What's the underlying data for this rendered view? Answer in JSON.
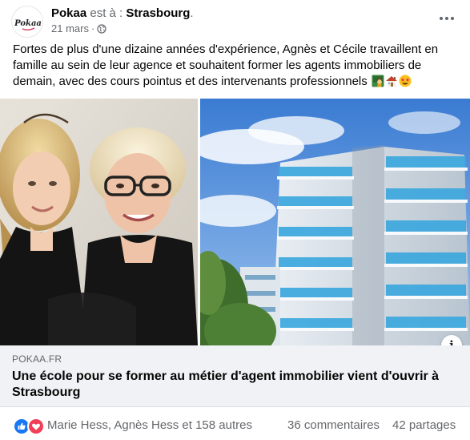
{
  "post": {
    "page_name": "Pokaa",
    "is_at": "est à :",
    "location": "Strasbourg",
    "location_dot": ".",
    "date": "21 mars",
    "dot": "·",
    "privacy_icon": "globe-icon",
    "logo_text": "Pokaa",
    "text": "Fortes de plus d'une dizaine années d'expérience, Agnès et Cécile travaillent en famille au sein de leur agence et souhaitent former les agents immobiliers de demain, avec des cours pointus et des intervenants professionnels",
    "emojis": [
      "woman-teacher-emoji",
      "house-emoji",
      "star-struck-emoji"
    ]
  },
  "link_preview": {
    "domain": "POKAA.FR",
    "title": "Une école pour se former au métier d'agent immobilier vient d'ouvrir à Strasbourg",
    "info_label": "i"
  },
  "footer": {
    "reactions": [
      "like-reaction-icon",
      "love-reaction-icon"
    ],
    "likers": "Marie Hess, Agnès Hess et 158 autres",
    "comments": "36 commentaires",
    "shares": "42 partages"
  },
  "colors": {
    "like_blue": "#1877f2",
    "love_red": "#f33e58",
    "secondary_text": "#65676b",
    "link_bg": "#f0f2f5"
  }
}
